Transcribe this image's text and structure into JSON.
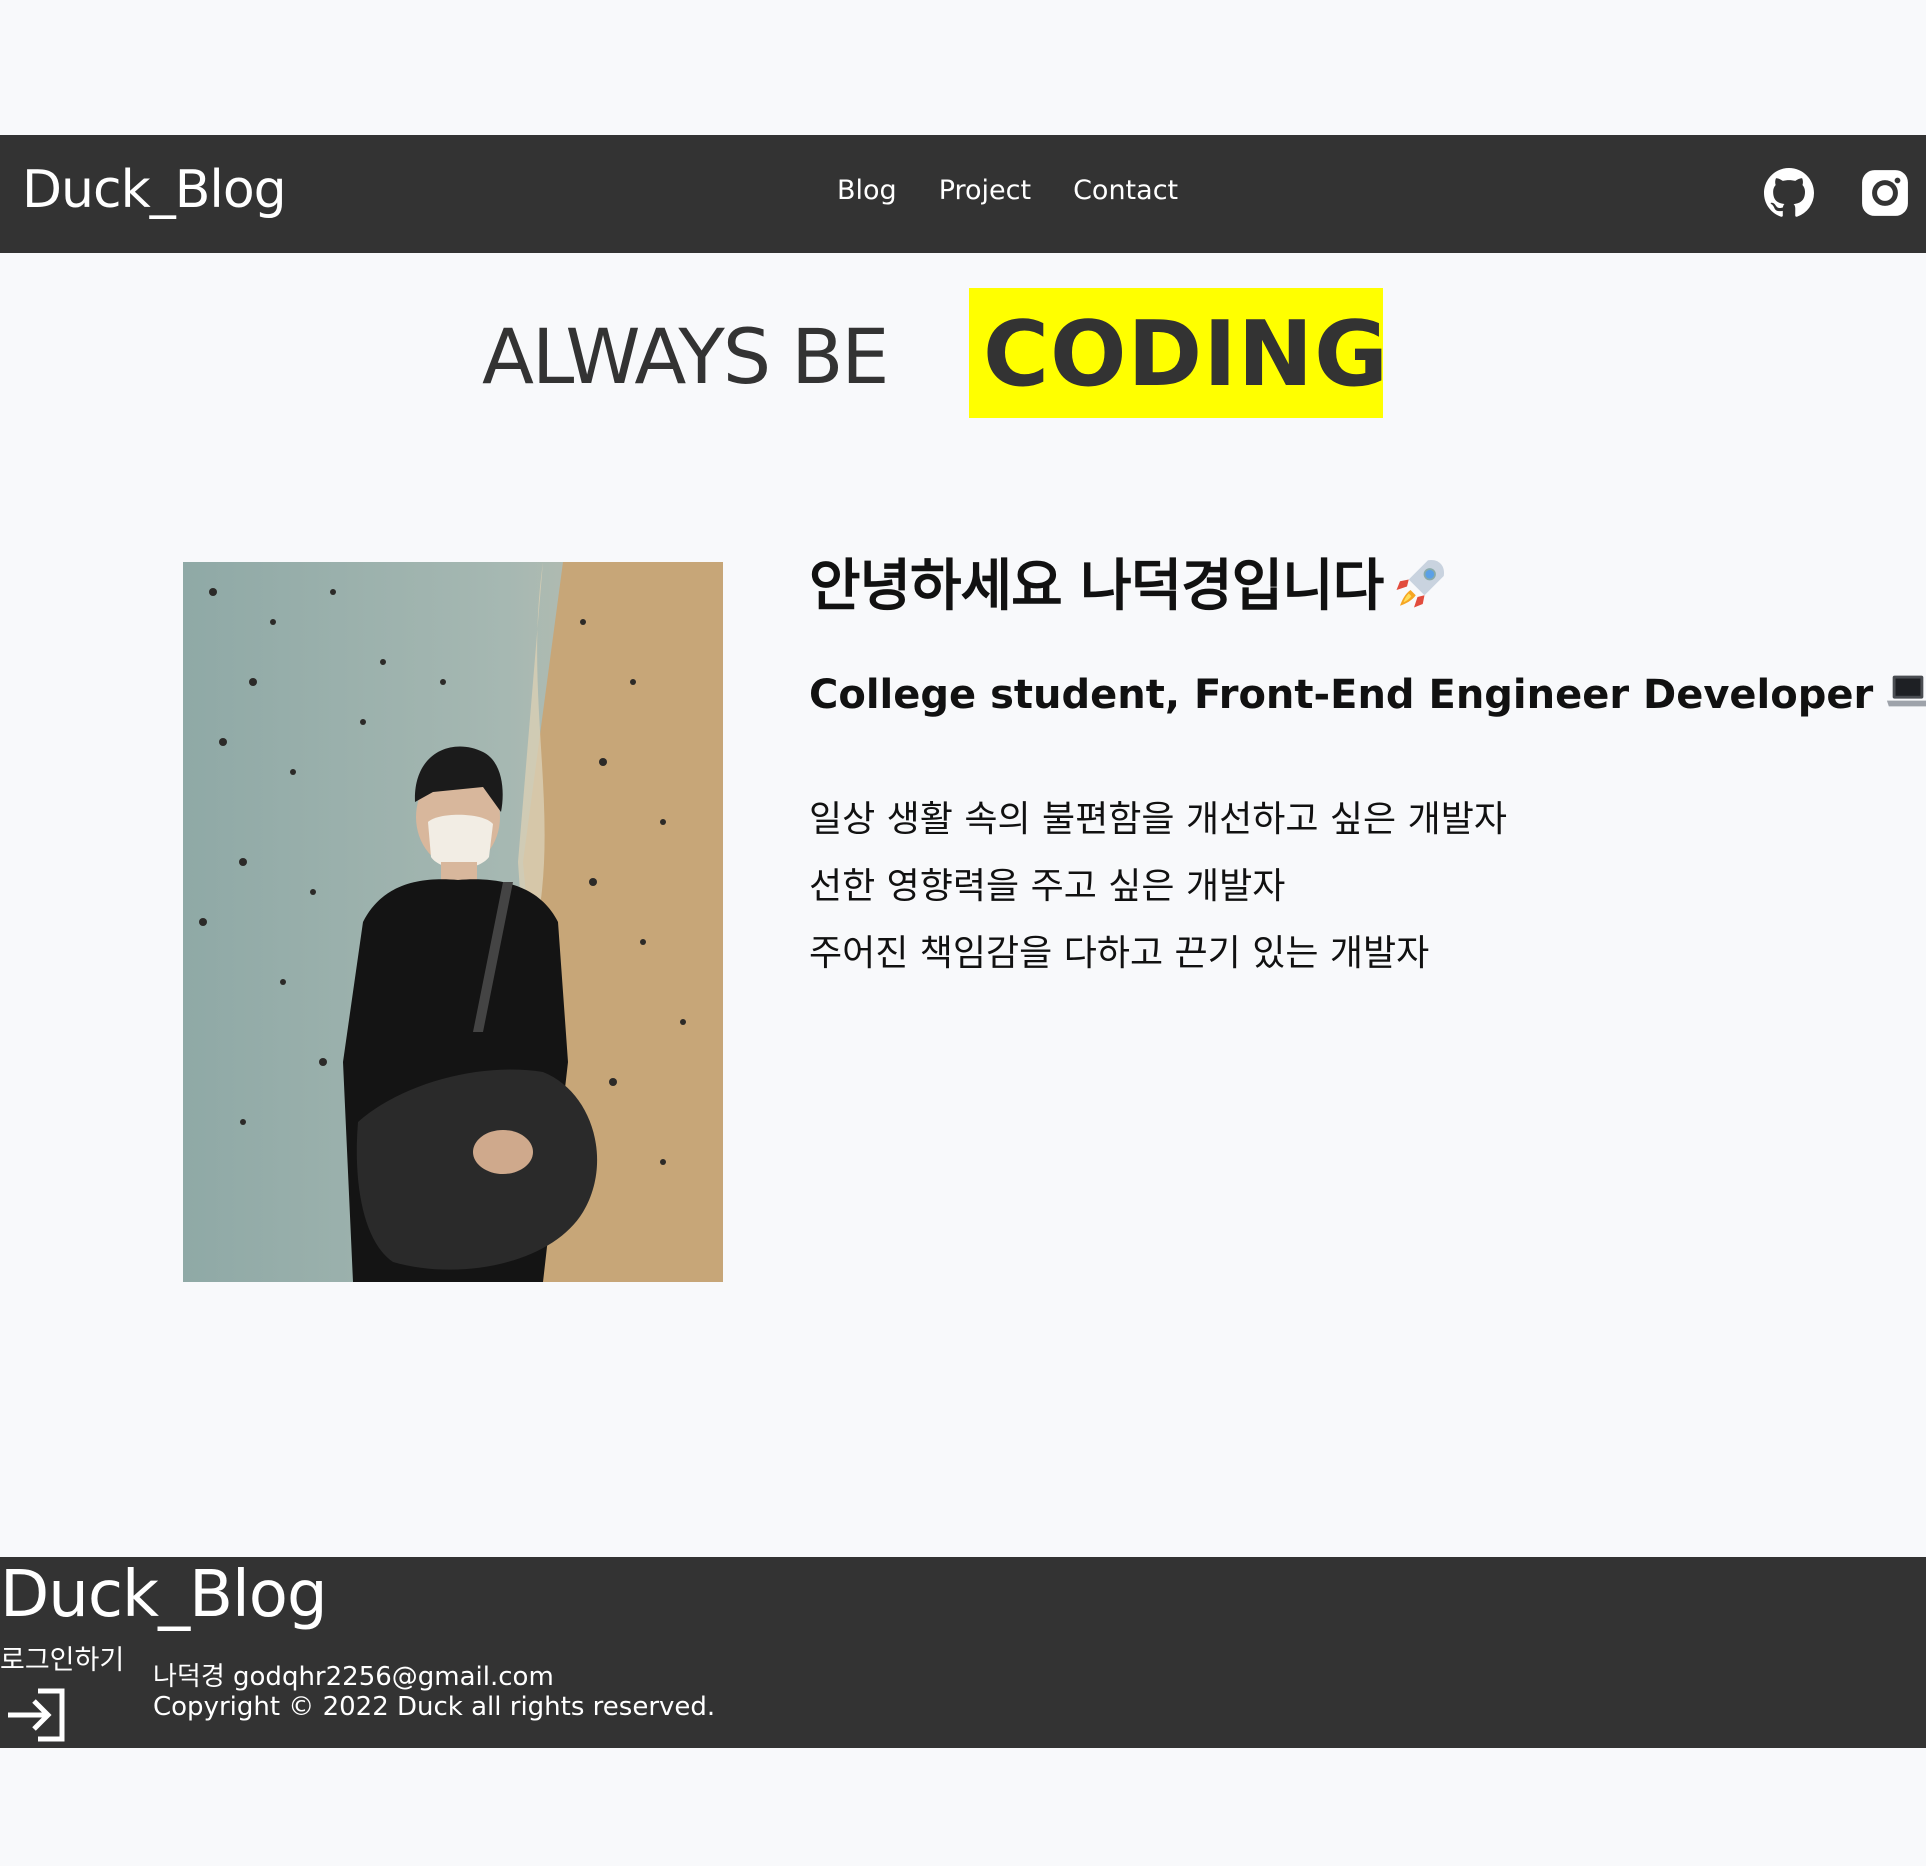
{
  "header": {
    "brand": "Duck_Blog",
    "nav": {
      "blog": "Blog",
      "project": "Project",
      "contact": "Contact"
    },
    "icons": [
      "github-icon",
      "instagram-icon"
    ]
  },
  "hero": {
    "left_text": "ALWAYS BE",
    "highlight_text": "CODING",
    "highlight_color": "#ffff00"
  },
  "profile": {
    "greeting": "안녕하세요 나덕경입니다",
    "greeting_icon": "rocket-icon",
    "subtitle": "College student, Front-End Engineer Developer",
    "subtitle_icon": "laptop-icon",
    "descriptions": [
      "일상 생활 속의 불편함을 개선하고 싶은 개발자",
      "선한 영향력을 주고 싶은 개발자",
      "주어진 책임감을 다하고 끈기 있는 개발자"
    ]
  },
  "footer": {
    "brand": "Duck_Blog",
    "login_label": "로그인하기",
    "login_icon": "login-icon",
    "contact": "나덕경 godqhr2256@gmail.com",
    "copyright": "Copyright © 2022 Duck all rights reserved."
  },
  "colors": {
    "background": "#f8f9fb",
    "bar": "#333333",
    "accent": "#ffff00"
  }
}
